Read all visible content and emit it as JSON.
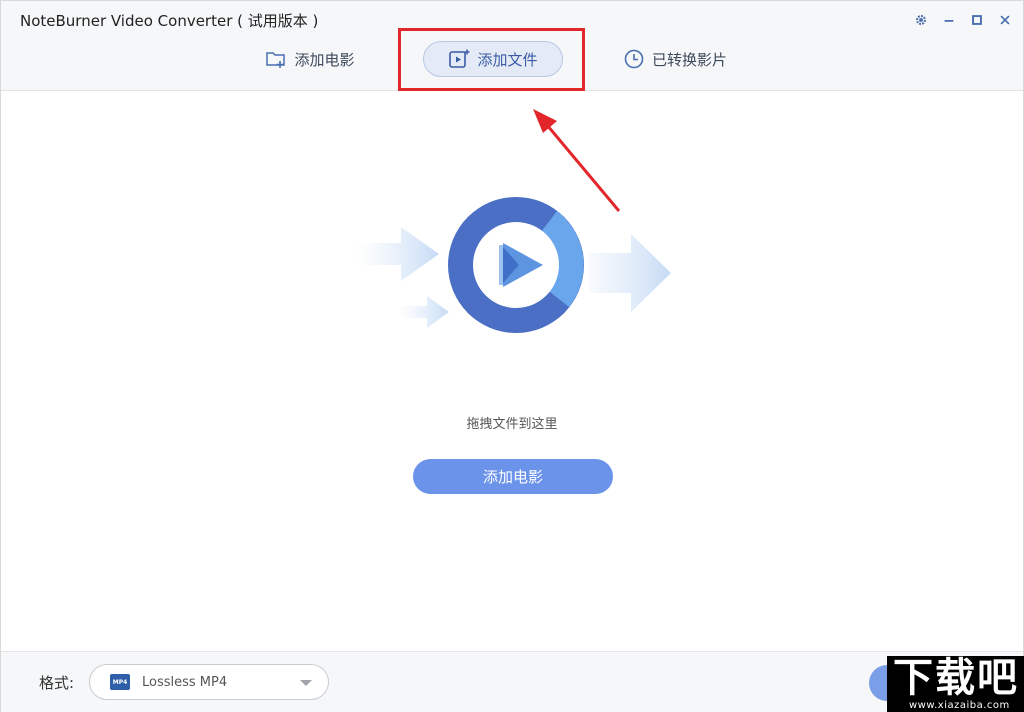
{
  "window": {
    "title": "NoteBurner Video Converter ( 试用版本 )",
    "controls": {
      "settings_icon": "gear-icon",
      "minimize_icon": "minimize-icon",
      "maximize_icon": "maximize-icon",
      "close_icon": "close-icon"
    }
  },
  "tabs": [
    {
      "label": "添加电影",
      "icon": "folder-plus-icon",
      "active": false
    },
    {
      "label": "添加文件",
      "icon": "video-add-icon",
      "active": true
    },
    {
      "label": "已转换影片",
      "icon": "clock-icon",
      "active": false
    }
  ],
  "main": {
    "drop_hint": "拖拽文件到这里",
    "add_movie_button": "添加电影"
  },
  "footer": {
    "format_label": "格式:",
    "format_value": "Lossless MP4",
    "format_icon_text": "MP4"
  },
  "watermark": {
    "brand": "下载吧",
    "domain": "www.xiazaiba.com"
  },
  "colors": {
    "accent": "#6c93ea",
    "highlight": "#e3262a",
    "ring_dark": "#4a6fc4",
    "ring_light": "#6aa6ec"
  }
}
